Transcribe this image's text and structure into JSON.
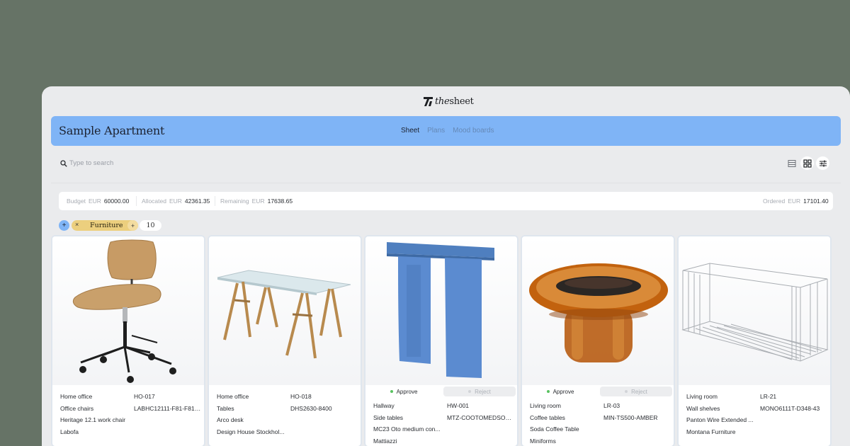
{
  "app": {
    "logo_text_italic": "the",
    "logo_text": "sheet",
    "logo_icon": "thesheet-logo-icon"
  },
  "header": {
    "project_title": "Sample Apartment",
    "nav": [
      {
        "label": "Sheet",
        "active": true
      },
      {
        "label": "Plans",
        "active": false
      },
      {
        "label": "Mood boards",
        "active": false
      }
    ]
  },
  "search": {
    "placeholder": "Type to search",
    "value": "",
    "icon": "search-icon"
  },
  "view_tools": [
    {
      "icon": "list-view-icon",
      "active": false
    },
    {
      "icon": "grid-view-icon",
      "active": true
    },
    {
      "icon": "sliders-icon",
      "active": true
    }
  ],
  "budget": {
    "budget": {
      "label": "Budget",
      "currency": "EUR",
      "value": "60000.00"
    },
    "allocated": {
      "label": "Allocated",
      "currency": "EUR",
      "value": "42361.35"
    },
    "remaining": {
      "label": "Remaining",
      "currency": "EUR",
      "value": "17638.65"
    },
    "ordered": {
      "label": "Ordered",
      "currency": "EUR",
      "value": "17101.40"
    }
  },
  "filters": {
    "add_symbol": "+",
    "chip": {
      "remove_symbol": "×",
      "label": "Furniture",
      "add_symbol": "+"
    },
    "count": "10"
  },
  "approval": {
    "approve_label": "Approve",
    "reject_label": "Reject"
  },
  "cards": [
    {
      "image": "desk chair",
      "room": "Home office",
      "code": "HO-017",
      "category": "Office chairs",
      "sku": "LABHC12111-F81-F81-E...",
      "name": "Heritage 12.1 work chair",
      "brand": "Labofa",
      "show_approval": false
    },
    {
      "image": "glass desk",
      "room": "Home office",
      "code": "HO-018",
      "category": "Tables",
      "sku": "DHS2630-8400",
      "name": "Arco desk",
      "brand": "Design House Stockhol...",
      "show_approval": false
    },
    {
      "image": "blue side table",
      "room": "Hallway",
      "code": "HW-001",
      "category": "Side tables",
      "sku": "MTZ-COOTOMEDSOK7S...",
      "name": "MC23 Oto medium con...",
      "brand": "Mattiazzi",
      "show_approval": true
    },
    {
      "image": "amber glass coffee table",
      "room": "Living room",
      "code": "LR-03",
      "category": "Coffee tables",
      "sku": "MIN-TS500-AMBER",
      "name": "Soda Coffee Table",
      "brand": "Miniforms",
      "show_approval": true
    },
    {
      "image": "wire wall shelf",
      "room": "Living room",
      "code": "LR-21",
      "category": "Wall shelves",
      "sku": "MONO6111T-D348-43",
      "name": "Panton Wire Extended ...",
      "brand": "Montana Furniture",
      "show_approval": false
    }
  ],
  "colors": {
    "background": "#667366",
    "header_blue": "#7fb4f6",
    "chip_yellow": "#eccf7e",
    "approve_green": "#58c25f"
  }
}
